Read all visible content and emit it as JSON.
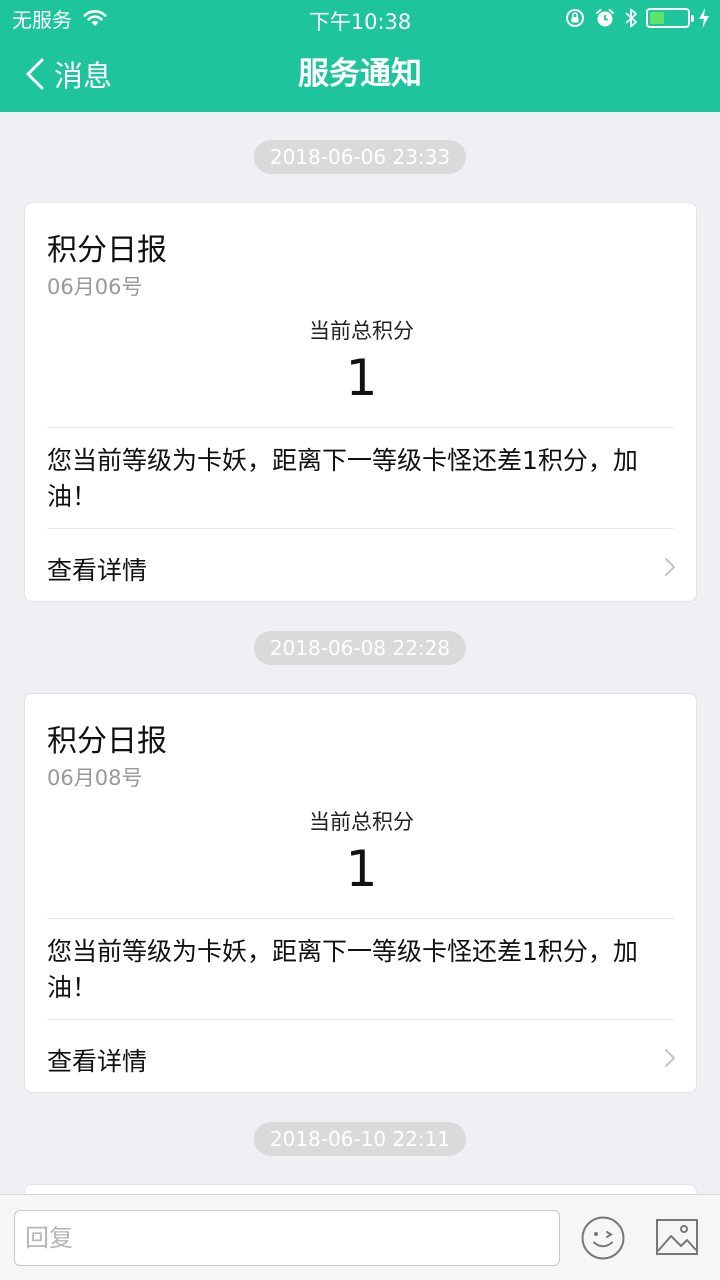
{
  "status_bar": {
    "carrier": "无服务",
    "time": "下午10:38",
    "battery_level": 0.4,
    "icons": [
      "wifi-icon",
      "orientation-lock-icon",
      "alarm-icon",
      "bluetooth-icon",
      "battery-icon",
      "charging-icon"
    ]
  },
  "nav": {
    "back_label": "消息",
    "title": "服务通知"
  },
  "messages": [
    {
      "timestamp": "2018-06-06 23:33",
      "title": "积分日报",
      "date": "06月06号",
      "score_label": "当前总积分",
      "score": "1",
      "message": "您当前等级为卡妖，距离下一等级卡怪还差1积分，加油！",
      "detail_label": "查看详情"
    },
    {
      "timestamp": "2018-06-08 22:28",
      "title": "积分日报",
      "date": "06月08号",
      "score_label": "当前总积分",
      "score": "1",
      "message": "您当前等级为卡妖，距离下一等级卡怪还差1积分，加油！",
      "detail_label": "查看详情"
    },
    {
      "timestamp": "2018-06-10 22:11"
    }
  ],
  "reply": {
    "placeholder": "回复",
    "value": ""
  },
  "colors": {
    "brand": "#1ec49c",
    "background": "#efeff4",
    "pill": "#dadada",
    "battery": "#5fe36b"
  }
}
